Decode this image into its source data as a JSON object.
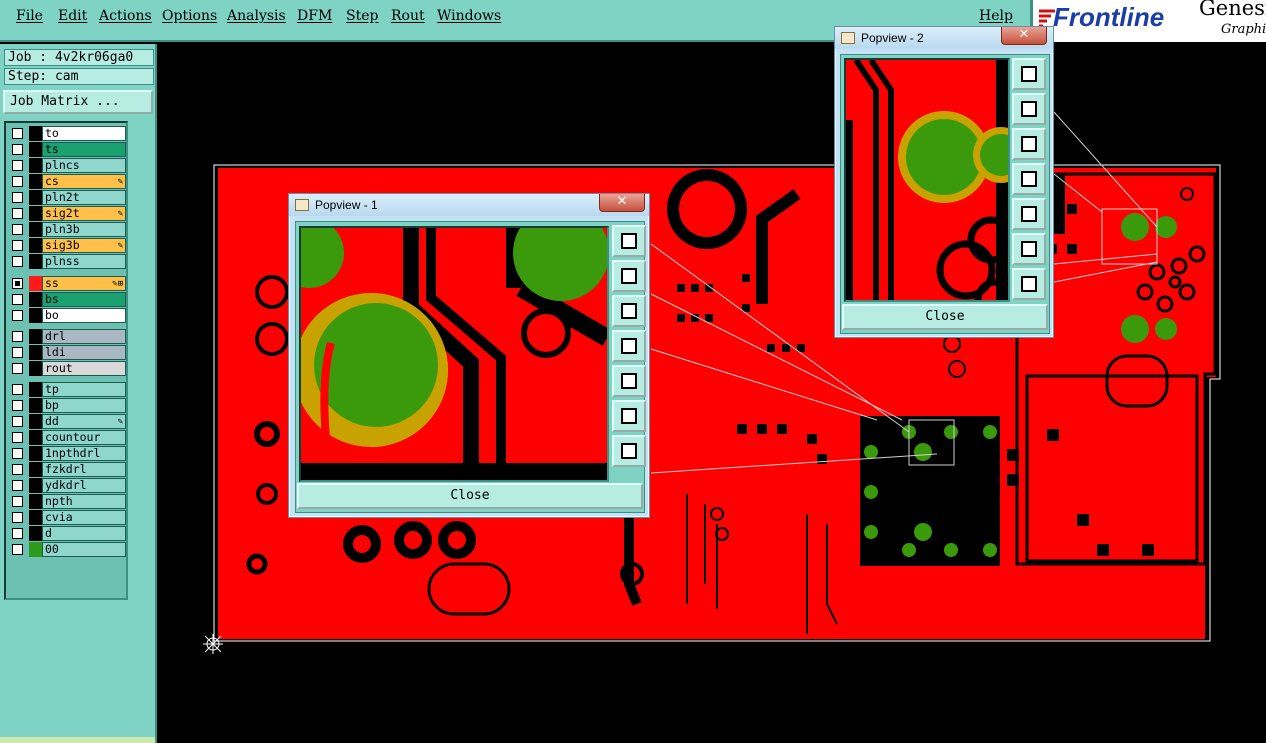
{
  "menu": {
    "items": [
      {
        "label": "File"
      },
      {
        "label": "Edit"
      },
      {
        "label": "Actions"
      },
      {
        "label": "Options"
      },
      {
        "label": "Analysis"
      },
      {
        "label": "DFM"
      },
      {
        "label": "Step"
      },
      {
        "label": "Rout"
      },
      {
        "label": "Windows"
      }
    ],
    "help": "Help"
  },
  "logo": {
    "brand": "Frontline",
    "product": "Genesis",
    "subtitle": "Graphic"
  },
  "job": {
    "job_label": "Job : 4v2kr06ga0",
    "step_label": "Step: cam",
    "matrix_button": "Job Matrix ..."
  },
  "layers": [
    {
      "name": "to",
      "color": "#ffffff",
      "swatch": "#000000",
      "checked": false,
      "mark": ""
    },
    {
      "name": "ts",
      "color": "#1aa16f",
      "swatch": "#000000",
      "checked": false,
      "mark": ""
    },
    {
      "name": "plncs",
      "color": "#8fd7cd",
      "swatch": "#000000",
      "checked": false,
      "mark": ""
    },
    {
      "name": "cs",
      "color": "#ffc04a",
      "swatch": "#000000",
      "checked": false,
      "mark": "✎"
    },
    {
      "name": "pln2t",
      "color": "#8fd7cd",
      "swatch": "#000000",
      "checked": false,
      "mark": ""
    },
    {
      "name": "sig2t",
      "color": "#ffc04a",
      "swatch": "#000000",
      "checked": false,
      "mark": "✎"
    },
    {
      "name": "pln3b",
      "color": "#8fd7cd",
      "swatch": "#000000",
      "checked": false,
      "mark": ""
    },
    {
      "name": "sig3b",
      "color": "#ffc04a",
      "swatch": "#000000",
      "checked": false,
      "mark": "✎"
    },
    {
      "name": "plnss",
      "color": "#8fd7cd",
      "swatch": "#000000",
      "checked": false,
      "mark": ""
    },
    {
      "name": "ss",
      "color": "#ffc04a",
      "swatch": "#ff1a1a",
      "checked": true,
      "mark": "✎⊞"
    },
    {
      "name": "bs",
      "color": "#1aa16f",
      "swatch": "#000000",
      "checked": false,
      "mark": ""
    },
    {
      "name": "bo",
      "color": "#ffffff",
      "swatch": "#000000",
      "checked": false,
      "mark": ""
    },
    {
      "name": "drl",
      "color": "#a9b8c2",
      "swatch": "#000000",
      "checked": false,
      "mark": ""
    },
    {
      "name": "ldi",
      "color": "#a9b8c2",
      "swatch": "#000000",
      "checked": false,
      "mark": ""
    },
    {
      "name": "rout",
      "color": "#d9d9d9",
      "swatch": "#000000",
      "checked": false,
      "mark": ""
    },
    {
      "name": "tp",
      "color": "#8fd7cd",
      "swatch": "#000000",
      "checked": false,
      "mark": ""
    },
    {
      "name": "bp",
      "color": "#8fd7cd",
      "swatch": "#000000",
      "checked": false,
      "mark": ""
    },
    {
      "name": "dd",
      "color": "#8fd7cd",
      "swatch": "#000000",
      "checked": false,
      "mark": "✎"
    },
    {
      "name": "countour",
      "color": "#8fd7cd",
      "swatch": "#000000",
      "checked": false,
      "mark": ""
    },
    {
      "name": "1npthdrl",
      "color": "#8fd7cd",
      "swatch": "#000000",
      "checked": false,
      "mark": ""
    },
    {
      "name": "fzkdrl",
      "color": "#8fd7cd",
      "swatch": "#000000",
      "checked": false,
      "mark": ""
    },
    {
      "name": "ydkdrl",
      "color": "#8fd7cd",
      "swatch": "#000000",
      "checked": false,
      "mark": ""
    },
    {
      "name": "npth",
      "color": "#8fd7cd",
      "swatch": "#000000",
      "checked": false,
      "mark": ""
    },
    {
      "name": "cvia",
      "color": "#8fd7cd",
      "swatch": "#000000",
      "checked": false,
      "mark": ""
    },
    {
      "name": "d",
      "color": "#8fd7cd",
      "swatch": "#000000",
      "checked": false,
      "mark": ""
    },
    {
      "name": "00",
      "color": "#8fd7cd",
      "swatch": "#2e9a1c",
      "checked": false,
      "mark": ""
    }
  ],
  "popview1": {
    "title": "Popview - 1",
    "close": "Close",
    "close_x": "✕"
  },
  "popview2": {
    "title": "Popview - 2",
    "close": "Close",
    "close_x": "✕"
  },
  "colors": {
    "copper": "#ff0000",
    "pad": "#3b9a0c",
    "pad_ring": "#c8a200",
    "panel": "#7fd3c5"
  }
}
